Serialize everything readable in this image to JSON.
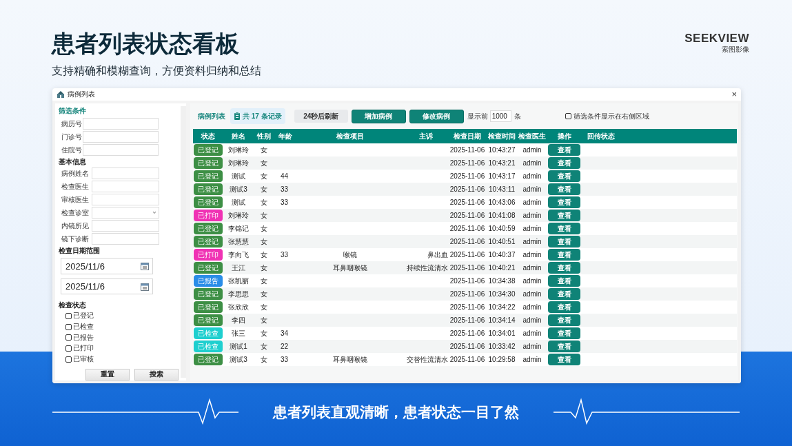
{
  "slide": {
    "title": "患者列表状态看板",
    "subtitle": "支持精确和模糊查询，方便资料归纳和总结",
    "logo": {
      "name": "SEEKVIEW",
      "tagline": "索图影像"
    },
    "caption": "患者列表直观清晰，患者状态一目了然"
  },
  "window": {
    "title": "病例列表",
    "close_glyph": "×"
  },
  "filter_panel": {
    "heading": "筛选条件",
    "id_fields": [
      {
        "label": "病历号",
        "kind": "text"
      },
      {
        "label": "门诊号",
        "kind": "text"
      },
      {
        "label": "住院号",
        "kind": "text"
      }
    ],
    "basic_heading": "基本信息",
    "basic_fields": [
      {
        "label": "病例姓名",
        "kind": "text"
      },
      {
        "label": "检查医生",
        "kind": "text"
      },
      {
        "label": "审核医生",
        "kind": "text"
      },
      {
        "label": "检查诊室",
        "kind": "dropdown"
      },
      {
        "label": "内镜所见",
        "kind": "text"
      },
      {
        "label": "镜下诊断",
        "kind": "text"
      }
    ],
    "date_heading": "检查日期范围",
    "dates": [
      "2025/11/6",
      "2025/11/6"
    ],
    "status_heading": "检查状态",
    "statuses": [
      {
        "label": "已登记",
        "checked": false
      },
      {
        "label": "已检查",
        "checked": false
      },
      {
        "label": "已报告",
        "checked": false
      },
      {
        "label": "已打印",
        "checked": false
      },
      {
        "label": "已审核",
        "checked": false
      }
    ],
    "buttons": [
      "重置",
      "搜索"
    ]
  },
  "toolbar": {
    "list_label": "病例列表",
    "record_count": "共 17 条记录",
    "refresh": "24秒后刷新",
    "buttons": [
      "增加病例",
      "修改病例"
    ],
    "show_prefix": "显示前",
    "show_count": "1000",
    "show_suffix": "条",
    "filter_right": {
      "label": "筛选条件显示在右侧区域",
      "checked": false
    }
  },
  "table": {
    "columns": [
      "状态",
      "姓名",
      "性别",
      "年龄",
      "检查项目",
      "主诉",
      "检查日期",
      "检查时间",
      "检查医生",
      "操作",
      "回传状态"
    ],
    "rows": [
      {
        "status": {
          "label": "已登记",
          "color": "#3d8f45"
        },
        "name": "刘琳玲",
        "gender": "女",
        "date": "2025-11-06",
        "time": "10:43:27",
        "doctor": "admin",
        "action": "查看"
      },
      {
        "status": {
          "label": "已登记",
          "color": "#3d8f45"
        },
        "name": "刘琳玲",
        "gender": "女",
        "date": "2025-11-06",
        "time": "10:43:21",
        "doctor": "admin",
        "action": "查看"
      },
      {
        "status": {
          "label": "已登记",
          "color": "#3d8f45"
        },
        "name": "测试",
        "gender": "女",
        "age": "44",
        "date": "2025-11-06",
        "time": "10:43:17",
        "doctor": "admin",
        "action": "查看"
      },
      {
        "status": {
          "label": "已登记",
          "color": "#3d8f45"
        },
        "name": "测试3",
        "gender": "女",
        "age": "33",
        "date": "2025-11-06",
        "time": "10:43:11",
        "doctor": "admin",
        "action": "查看"
      },
      {
        "status": {
          "label": "已登记",
          "color": "#3d8f45"
        },
        "name": "测试",
        "gender": "女",
        "age": "33",
        "date": "2025-11-06",
        "time": "10:43:06",
        "doctor": "admin",
        "action": "查看"
      },
      {
        "status": {
          "label": "已打印",
          "color": "#f032b4"
        },
        "name": "刘琳玲",
        "gender": "女",
        "date": "2025-11-06",
        "time": "10:41:08",
        "doctor": "admin",
        "action": "查看"
      },
      {
        "status": {
          "label": "已登记",
          "color": "#3d8f45"
        },
        "name": "李锦记",
        "gender": "女",
        "date": "2025-11-06",
        "time": "10:40:59",
        "doctor": "admin",
        "action": "查看"
      },
      {
        "status": {
          "label": "已登记",
          "color": "#3d8f45"
        },
        "name": "张慧慧",
        "gender": "女",
        "date": "2025-11-06",
        "time": "10:40:51",
        "doctor": "admin",
        "action": "查看"
      },
      {
        "status": {
          "label": "已打印",
          "color": "#f032b4"
        },
        "name": "李向飞",
        "gender": "女",
        "age": "33",
        "exam_item": "喉镜",
        "complaint": "鼻出血",
        "date": "2025-11-06",
        "time": "10:40:37",
        "doctor": "admin",
        "action": "查看"
      },
      {
        "status": {
          "label": "已登记",
          "color": "#3d8f45"
        },
        "name": "王江",
        "gender": "女",
        "exam_item": "耳鼻咽喉镜",
        "complaint": "持续性流清水",
        "date": "2025-11-06",
        "time": "10:40:21",
        "doctor": "admin",
        "action": "查看"
      },
      {
        "status": {
          "label": "已报告",
          "color": "#2a8de8"
        },
        "name": "张凯丽",
        "gender": "女",
        "date": "2025-11-06",
        "time": "10:34:38",
        "doctor": "admin",
        "action": "查看"
      },
      {
        "status": {
          "label": "已登记",
          "color": "#3d8f45"
        },
        "name": "李思思",
        "gender": "女",
        "date": "2025-11-06",
        "time": "10:34:30",
        "doctor": "admin",
        "action": "查看"
      },
      {
        "status": {
          "label": "已登记",
          "color": "#3d8f45"
        },
        "name": "张欣欣",
        "gender": "女",
        "date": "2025-11-06",
        "time": "10:34:22",
        "doctor": "admin",
        "action": "查看"
      },
      {
        "status": {
          "label": "已登记",
          "color": "#3d8f45"
        },
        "name": "李四",
        "gender": "女",
        "date": "2025-11-06",
        "time": "10:34:14",
        "doctor": "admin",
        "action": "查看"
      },
      {
        "status": {
          "label": "已检查",
          "color": "#1ecfcf"
        },
        "name": "张三",
        "gender": "女",
        "age": "34",
        "date": "2025-11-06",
        "time": "10:34:01",
        "doctor": "admin",
        "action": "查看"
      },
      {
        "status": {
          "label": "已检查",
          "color": "#1ecfcf"
        },
        "name": "测试1",
        "gender": "女",
        "age": "22",
        "date": "2025-11-06",
        "time": "10:33:42",
        "doctor": "admin",
        "action": "查看"
      },
      {
        "status": {
          "label": "已登记",
          "color": "#3d8f45"
        },
        "name": "测试3",
        "gender": "女",
        "age": "33",
        "exam_item": "耳鼻咽喉镜",
        "complaint": "交替性流清水",
        "date": "2025-11-06",
        "time": "10:29:58",
        "doctor": "admin",
        "action": "查看"
      }
    ]
  }
}
